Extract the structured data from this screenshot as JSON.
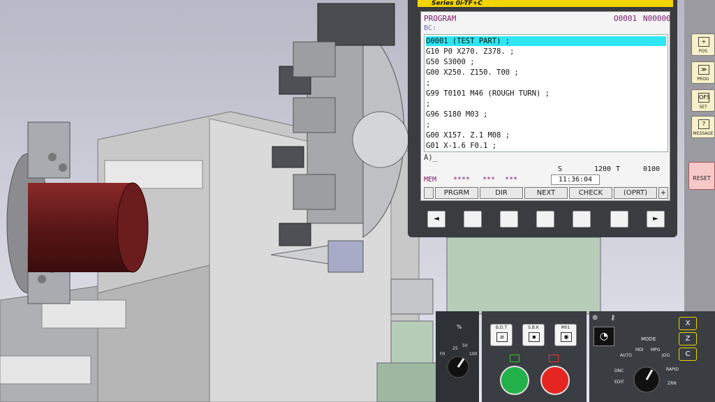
{
  "cnc": {
    "series": "Series 0i-TF+C",
    "screen_title": "PROGRAM",
    "program_number": "O0001",
    "sequence_number": "N00000",
    "bc_label": "BC:",
    "program_lines": [
      "O0001 (TEST PART) ;",
      "G10 P0 X270. Z378. ;",
      "G50 S3000 ;",
      "G00 X250. Z150. T00 ;",
      ";",
      "G99 T0101 M46 (ROUGH TURN) ;",
      ";",
      "G96 S180 M03 ;",
      ";",
      "G00 X157. Z.1 M08 ;",
      "G01 X-1.6 F0.1 ;"
    ],
    "input_prompt": "A)_",
    "status": {
      "s_label": "S",
      "s_value": "1200",
      "t_label": "T",
      "t_value": "0100"
    },
    "mode": {
      "mode": "MEM",
      "stars1": "****",
      "stars2": "***",
      "stars3": "***",
      "clock": "11:36:04"
    },
    "softkeys": [
      "PRGRM",
      "DIR",
      "NEXT",
      "CHECK",
      "(OPRT)"
    ],
    "softkey_left": "",
    "softkey_right": "+",
    "nav_left": "◄",
    "nav_right": "►"
  },
  "function_keys": [
    {
      "label": "POS",
      "icon": "+"
    },
    {
      "label": "PROG",
      "icon": "≫"
    },
    {
      "label": "SET",
      "icon": "OFS"
    },
    {
      "label": "MESSAGE",
      "icon": "?"
    }
  ],
  "reset_label": "RESET",
  "operator_panel": {
    "feed_label": "%",
    "feed_marks": [
      "25",
      "50",
      "F0",
      "100"
    ],
    "keys": [
      {
        "label": "B.D.T",
        "glyph": "⧄"
      },
      {
        "label": "S.B.K",
        "glyph": "▪"
      },
      {
        "label": "M01",
        "glyph": "◉"
      }
    ],
    "start_color": "#22b04b",
    "stop_color": "#e52521",
    "mode_title": "MODE",
    "mode_positions": [
      "AUTO",
      "MDI",
      "MPG",
      "JOG",
      "RAPID",
      "ZRN",
      "EDIT",
      "DNC"
    ],
    "axis_keys": [
      "X",
      "Z",
      "C"
    ]
  },
  "colors": {
    "chuck_red": "#6b1d1d",
    "machine_green": "#b7cdb8",
    "series_banner": "#f2d400",
    "highlight": "#2ee6f2"
  }
}
